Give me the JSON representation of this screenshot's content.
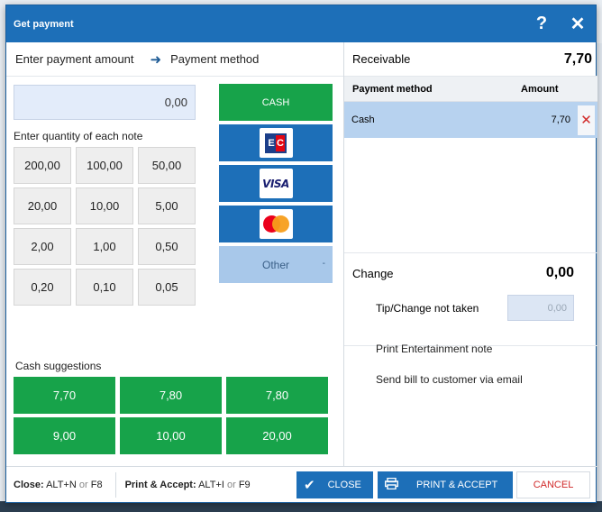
{
  "dialog": {
    "title": "Get payment",
    "help": "?",
    "close": "✕"
  },
  "steps": {
    "step1": "Enter payment amount",
    "arrow": "➜",
    "step2": "Payment method"
  },
  "amount": {
    "value": "0,00"
  },
  "notes": {
    "label": "Enter quantity of each note",
    "items": [
      "200,00",
      "100,00",
      "50,00",
      "20,00",
      "10,00",
      "5,00",
      "2,00",
      "1,00",
      "0,50",
      "0,20",
      "0,10",
      "0,05"
    ]
  },
  "methods": {
    "cash": "CASH",
    "ec_e": "E",
    "ec_c": "C",
    "visa": "VISA",
    "other": "Other",
    "other_dash": "-"
  },
  "suggestions": {
    "label": "Cash suggestions",
    "items": [
      "7,70",
      "7,80",
      "7,80",
      "9,00",
      "10,00",
      "20,00"
    ]
  },
  "receivable": {
    "label": "Receivable",
    "value": "7,70"
  },
  "payment_table": {
    "col_method": "Payment method",
    "col_amount": "Amount",
    "rows": [
      {
        "method": "Cash",
        "amount": "7,70",
        "delete": "✕"
      }
    ]
  },
  "change": {
    "label": "Change",
    "value": "0,00",
    "tip_label": "Tip/Change not taken",
    "tip_value": "0,00"
  },
  "extras": {
    "print_note": "Print Entertainment note",
    "send_email": "Send bill to customer via email"
  },
  "footer": {
    "close_label": "Close:",
    "close_keys": "ALT+N",
    "or1": "or",
    "close_alt": "F8",
    "print_label": "Print & Accept:",
    "print_keys": "ALT+I",
    "or2": "or",
    "print_alt": "F9",
    "close_btn": "CLOSE",
    "print_btn": "PRINT & ACCEPT",
    "cancel_btn": "CANCEL"
  },
  "colors": {
    "brand_blue": "#1d6fb8",
    "accent_green": "#17a34a",
    "danger_red": "#d12a2a"
  }
}
